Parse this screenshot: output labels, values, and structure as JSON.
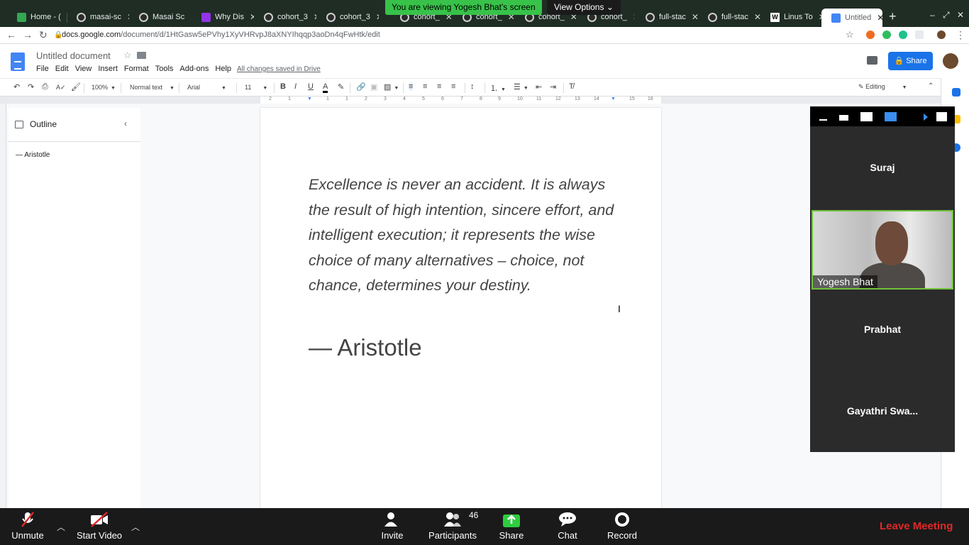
{
  "browser": {
    "tabs": [
      {
        "label": "Home - (",
        "icon": "evernote"
      },
      {
        "label": "masai-sc",
        "icon": "github"
      },
      {
        "label": "Masai Sc",
        "icon": "github"
      },
      {
        "label": "Why Dis",
        "icon": "purple"
      },
      {
        "label": "cohort_3",
        "icon": "github"
      },
      {
        "label": "cohort_3",
        "icon": "github"
      },
      {
        "label": "cohort_",
        "icon": "github"
      },
      {
        "label": "cohort_",
        "icon": "github"
      },
      {
        "label": "cohort_",
        "icon": "github"
      },
      {
        "label": "cohort_",
        "icon": "github"
      },
      {
        "label": "full-stac",
        "icon": "github"
      },
      {
        "label": "full-stac",
        "icon": "github"
      },
      {
        "label": "Linus To",
        "icon": "wikipedia"
      },
      {
        "label": "Untitled",
        "icon": "docs"
      }
    ],
    "url_host": "docs.google.com",
    "url_path": "/document/d/1HtGasw5ePVhy1XyVHRvpJ8aXNYIhqqp3aoDn4qFwHtk/edit"
  },
  "banner": {
    "viewing_text": "You are viewing Yogesh Bhat's screen",
    "view_options": "View Options"
  },
  "docs": {
    "title": "Untitled document",
    "menu": [
      "File",
      "Edit",
      "View",
      "Insert",
      "Format",
      "Tools",
      "Add-ons",
      "Help"
    ],
    "saved_status": "All changes saved in Drive",
    "share_label": "Share",
    "toolbar": {
      "zoom": "100%",
      "style": "Normal text",
      "font": "Arial",
      "size": "11",
      "mode": "Editing"
    },
    "ruler_ticks": [
      "2",
      "1",
      "1",
      "1",
      "2",
      "3",
      "4",
      "5",
      "6",
      "7",
      "8",
      "9",
      "10",
      "11",
      "12",
      "13",
      "14",
      "15",
      "16",
      "17",
      "18"
    ],
    "outline": {
      "title": "Outline",
      "items": [
        "Aristotle"
      ]
    },
    "quote": "Excellence is never an accident. It is always the result of high intention, sincere effort, and intelligent execution; it represents the wise choice of many alternatives – choice, not chance, determines your destiny.",
    "author": "— Aristotle"
  },
  "gallery": {
    "participants": [
      "Suraj",
      "Prabhat",
      "Gayathri Swa..."
    ],
    "active_speaker": "Yogesh Bhat"
  },
  "zoom": {
    "buttons": {
      "unmute": "Unmute",
      "start_video": "Start Video",
      "invite": "Invite",
      "participants": "Participants",
      "participants_count": "46",
      "share": "Share",
      "chat": "Chat",
      "record": "Record"
    },
    "leave": "Leave Meeting",
    "colors": {
      "share_green": "#2ecc40",
      "leave_red": "#e02828",
      "active_border": "#70c23d"
    }
  }
}
